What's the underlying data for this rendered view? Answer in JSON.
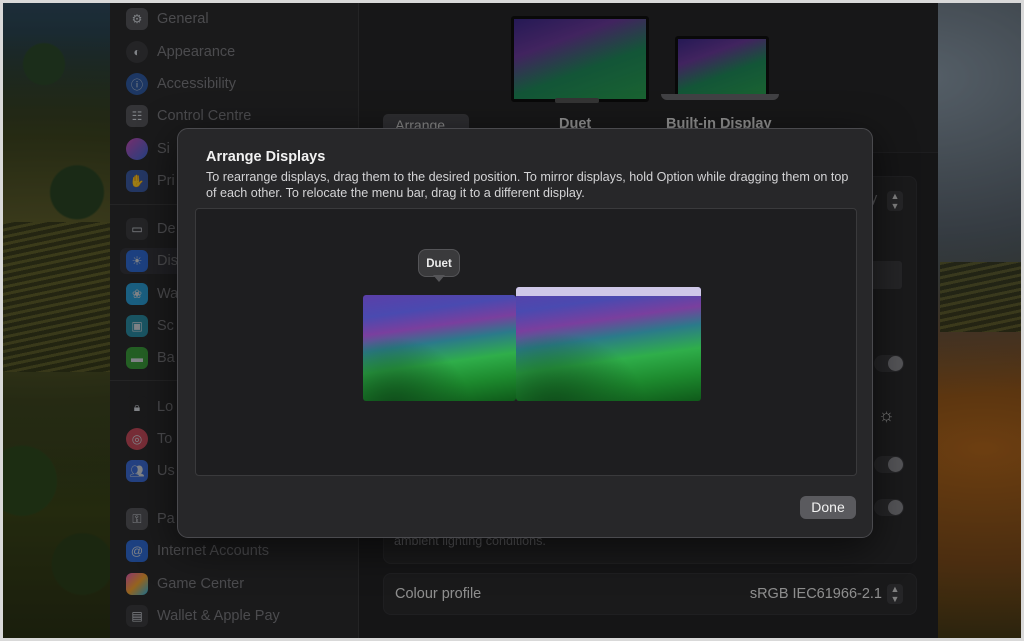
{
  "sidebar": {
    "items": [
      {
        "label": "General",
        "icon": "gear-icon"
      },
      {
        "label": "Appearance",
        "icon": "appearance-icon"
      },
      {
        "label": "Accessibility",
        "icon": "accessibility-icon"
      },
      {
        "label": "Control Centre",
        "icon": "control-centre-icon"
      },
      {
        "label": "Si",
        "icon": "siri-icon"
      },
      {
        "label": "Pri",
        "icon": "privacy-hand-icon"
      },
      {
        "label": "De",
        "icon": "desktop-icon"
      },
      {
        "label": "Dis",
        "icon": "displays-sun-icon"
      },
      {
        "label": "Wa",
        "icon": "wallpaper-icon"
      },
      {
        "label": "Sc",
        "icon": "screen-saver-icon"
      },
      {
        "label": "Ba",
        "icon": "battery-icon"
      },
      {
        "label": "Lo",
        "icon": "lock-icon"
      },
      {
        "label": "To",
        "icon": "touch-id-icon"
      },
      {
        "label": "Us",
        "icon": "users-icon"
      },
      {
        "label": "Pa",
        "icon": "passwords-icon"
      },
      {
        "label": "Internet Accounts",
        "icon": "at-icon"
      },
      {
        "label": "Game Center",
        "icon": "game-center-icon"
      },
      {
        "label": "Wallet & Apple Pay",
        "icon": "wallet-icon"
      }
    ]
  },
  "main": {
    "arrange_button": "Arrange...",
    "display_labels": {
      "external": "Duet",
      "builtin": "Built-in Display"
    },
    "partial_text": {
      "use_as_suffix": "y",
      "ambient": "ambient lighting conditions."
    },
    "colour_profile": {
      "label": "Colour profile",
      "value": "sRGB IEC61966-2.1"
    }
  },
  "sheet": {
    "title": "Arrange Displays",
    "description": "To rearrange displays, drag them to the desired position. To mirror displays, hold Option while dragging them on top of each other. To relocate the menu bar, drag it to a different display.",
    "tooltip": "Duet",
    "done_label": "Done"
  },
  "colors": {
    "accent": "#5a5a5e",
    "sheet_background": "#272729",
    "menu_bar": "#cfc8e8"
  }
}
